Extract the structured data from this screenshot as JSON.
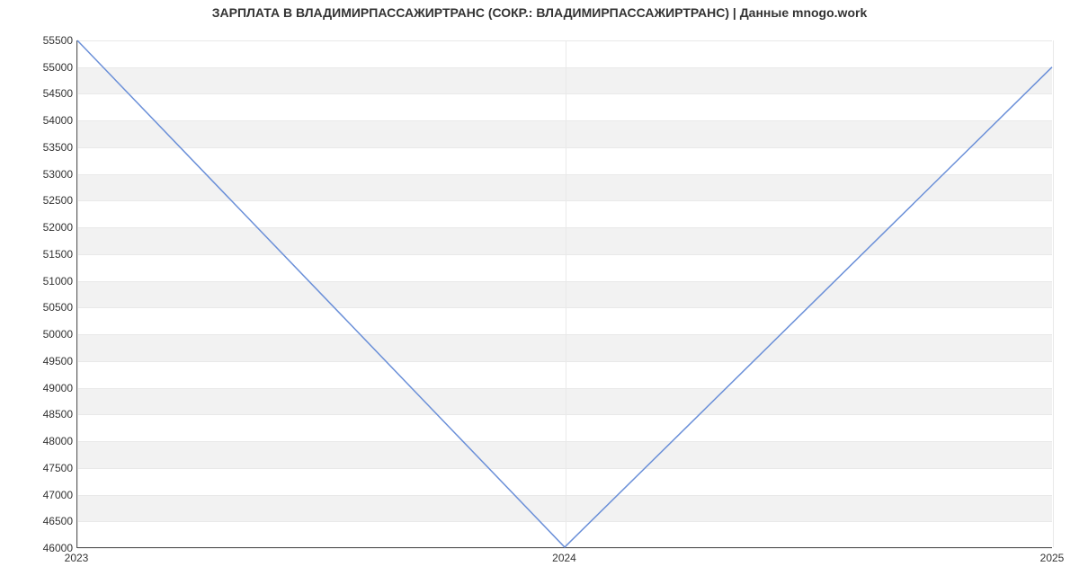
{
  "chart_data": {
    "type": "line",
    "title": "ЗАРПЛАТА В  ВЛАДИМИРПАССАЖИРТРАНС (СОКР.: ВЛАДИМИРПАССАЖИРТРАНС) | Данные mnogo.work",
    "xlabel": "",
    "ylabel": "",
    "x": [
      2023,
      2024,
      2025
    ],
    "values": [
      55500,
      46000,
      55000
    ],
    "x_ticks": [
      "2023",
      "2024",
      "2025"
    ],
    "y_ticks": [
      46000,
      46500,
      47000,
      47500,
      48000,
      48500,
      49000,
      49500,
      50000,
      50500,
      51000,
      51500,
      52000,
      52500,
      53000,
      53500,
      54000,
      54500,
      55000,
      55500
    ],
    "ylim": [
      46000,
      55500
    ],
    "xlim": [
      2023,
      2025
    ],
    "line_color": "#6a8fd8",
    "grid": true
  }
}
